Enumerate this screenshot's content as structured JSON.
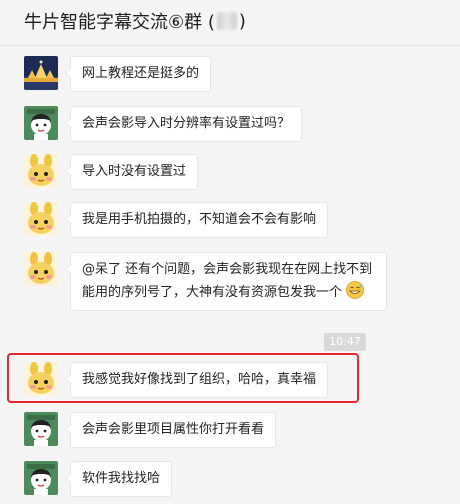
{
  "header": {
    "title_prefix": "牛片智能字幕交流⑥群 (",
    "title_suffix": ")"
  },
  "messages": [
    {
      "sender": "night-city",
      "text": "网上教程还是挺多的"
    },
    {
      "sender": "cartoon-girl",
      "text": "会声会影导入时分辨率有设置过吗？"
    },
    {
      "sender": "bunny",
      "text": "导入时没有设置过"
    },
    {
      "sender": "bunny",
      "text": "我是用手机拍摄的，不知道会不会有影响"
    },
    {
      "sender": "bunny",
      "text": "@呆了 还有个问题，会声会影我现在在网上找不到能用的序列号了，大神有没有资源包发我一个",
      "emoji": "grinning-sweat-emoji"
    },
    {
      "sender": "bunny",
      "text": "我感觉我好像找到了组织，哈哈，真幸福"
    },
    {
      "sender": "cartoon-girl",
      "text": "会声会影里项目属性你打开看看"
    },
    {
      "sender": "cartoon-girl",
      "text": "软件我找找哈"
    }
  ],
  "timestamp": "10:47",
  "colors": {
    "highlight": "#e8262b",
    "bubble": "#ffffff",
    "background": "#f5f5f5"
  }
}
